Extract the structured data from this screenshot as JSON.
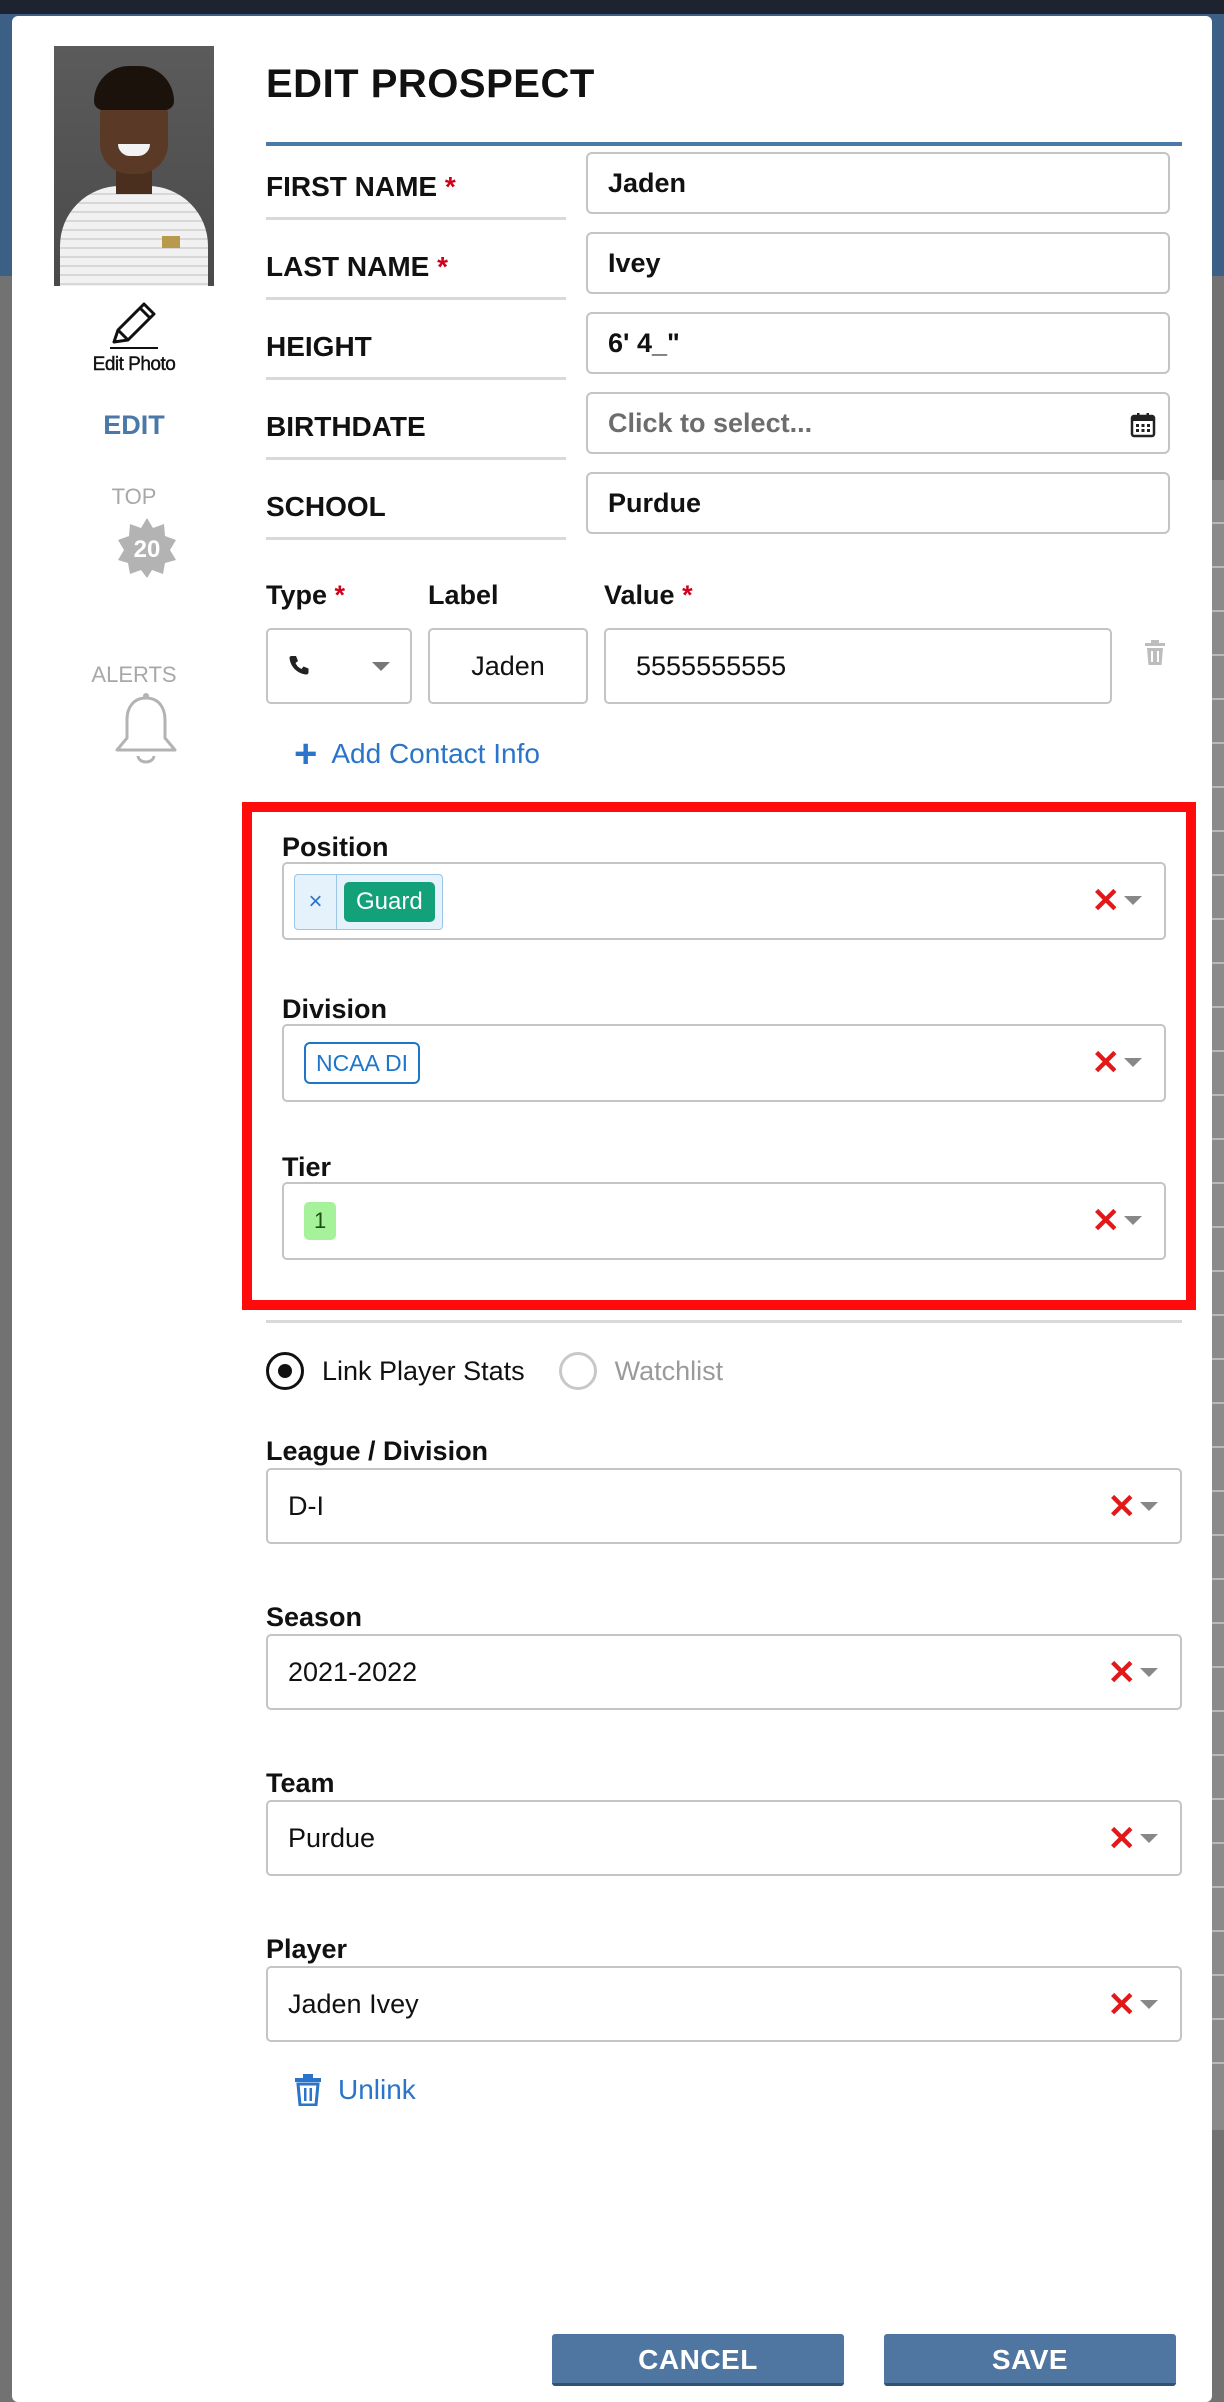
{
  "modal": {
    "title": "EDIT PROSPECT"
  },
  "sidebar": {
    "edit_photo_label": "Edit Photo",
    "edit_link": "EDIT",
    "top_label": "TOP",
    "top_badge": "20",
    "alerts_label": "ALERTS"
  },
  "fields": {
    "first_name": {
      "label": "FIRST NAME",
      "required": "*",
      "value": "Jaden"
    },
    "last_name": {
      "label": "LAST NAME",
      "required": "*",
      "value": "Ivey"
    },
    "height": {
      "label": "HEIGHT",
      "value": "6' 4_\""
    },
    "birthdate": {
      "label": "BIRTHDATE",
      "placeholder": "Click to select..."
    },
    "school": {
      "label": "SCHOOL",
      "value": "Purdue"
    }
  },
  "contact": {
    "type_label": "Type",
    "label_label": "Label",
    "value_label": "Value",
    "required": "*",
    "type_icon": "phone-icon",
    "label_value": "Jaden",
    "value_value": "5555555555",
    "add_label": "Add Contact Info"
  },
  "classification": {
    "position": {
      "label": "Position",
      "chip_remove": "×",
      "chip": "Guard"
    },
    "division": {
      "label": "Division",
      "chip": "NCAA DI"
    },
    "tier": {
      "label": "Tier",
      "chip": "1"
    }
  },
  "stats_link": {
    "options": [
      "Link Player Stats",
      "Watchlist"
    ],
    "selected": "Link Player Stats",
    "league": {
      "label": "League / Division",
      "value": "D-I"
    },
    "season": {
      "label": "Season",
      "value": "2021-2022"
    },
    "team": {
      "label": "Team",
      "value": "Purdue"
    },
    "player": {
      "label": "Player",
      "value": "Jaden Ivey"
    },
    "unlink_label": "Unlink"
  },
  "buttons": {
    "cancel": "CANCEL",
    "save": "SAVE"
  },
  "colors": {
    "accent_blue": "#4a78a7",
    "link_blue": "#2a74c9",
    "required_red": "#d0021b",
    "highlight_red": "#ff0b0b",
    "chip_green": "#13a17a",
    "button_blue": "#4f76a1"
  },
  "icons": {
    "clear": "clear-x-icon",
    "dropdown": "chevron-down-icon",
    "calendar": "calendar-icon",
    "trash": "trash-icon",
    "bell": "bell-icon",
    "pencil": "pencil-icon",
    "plus": "plus-icon"
  }
}
